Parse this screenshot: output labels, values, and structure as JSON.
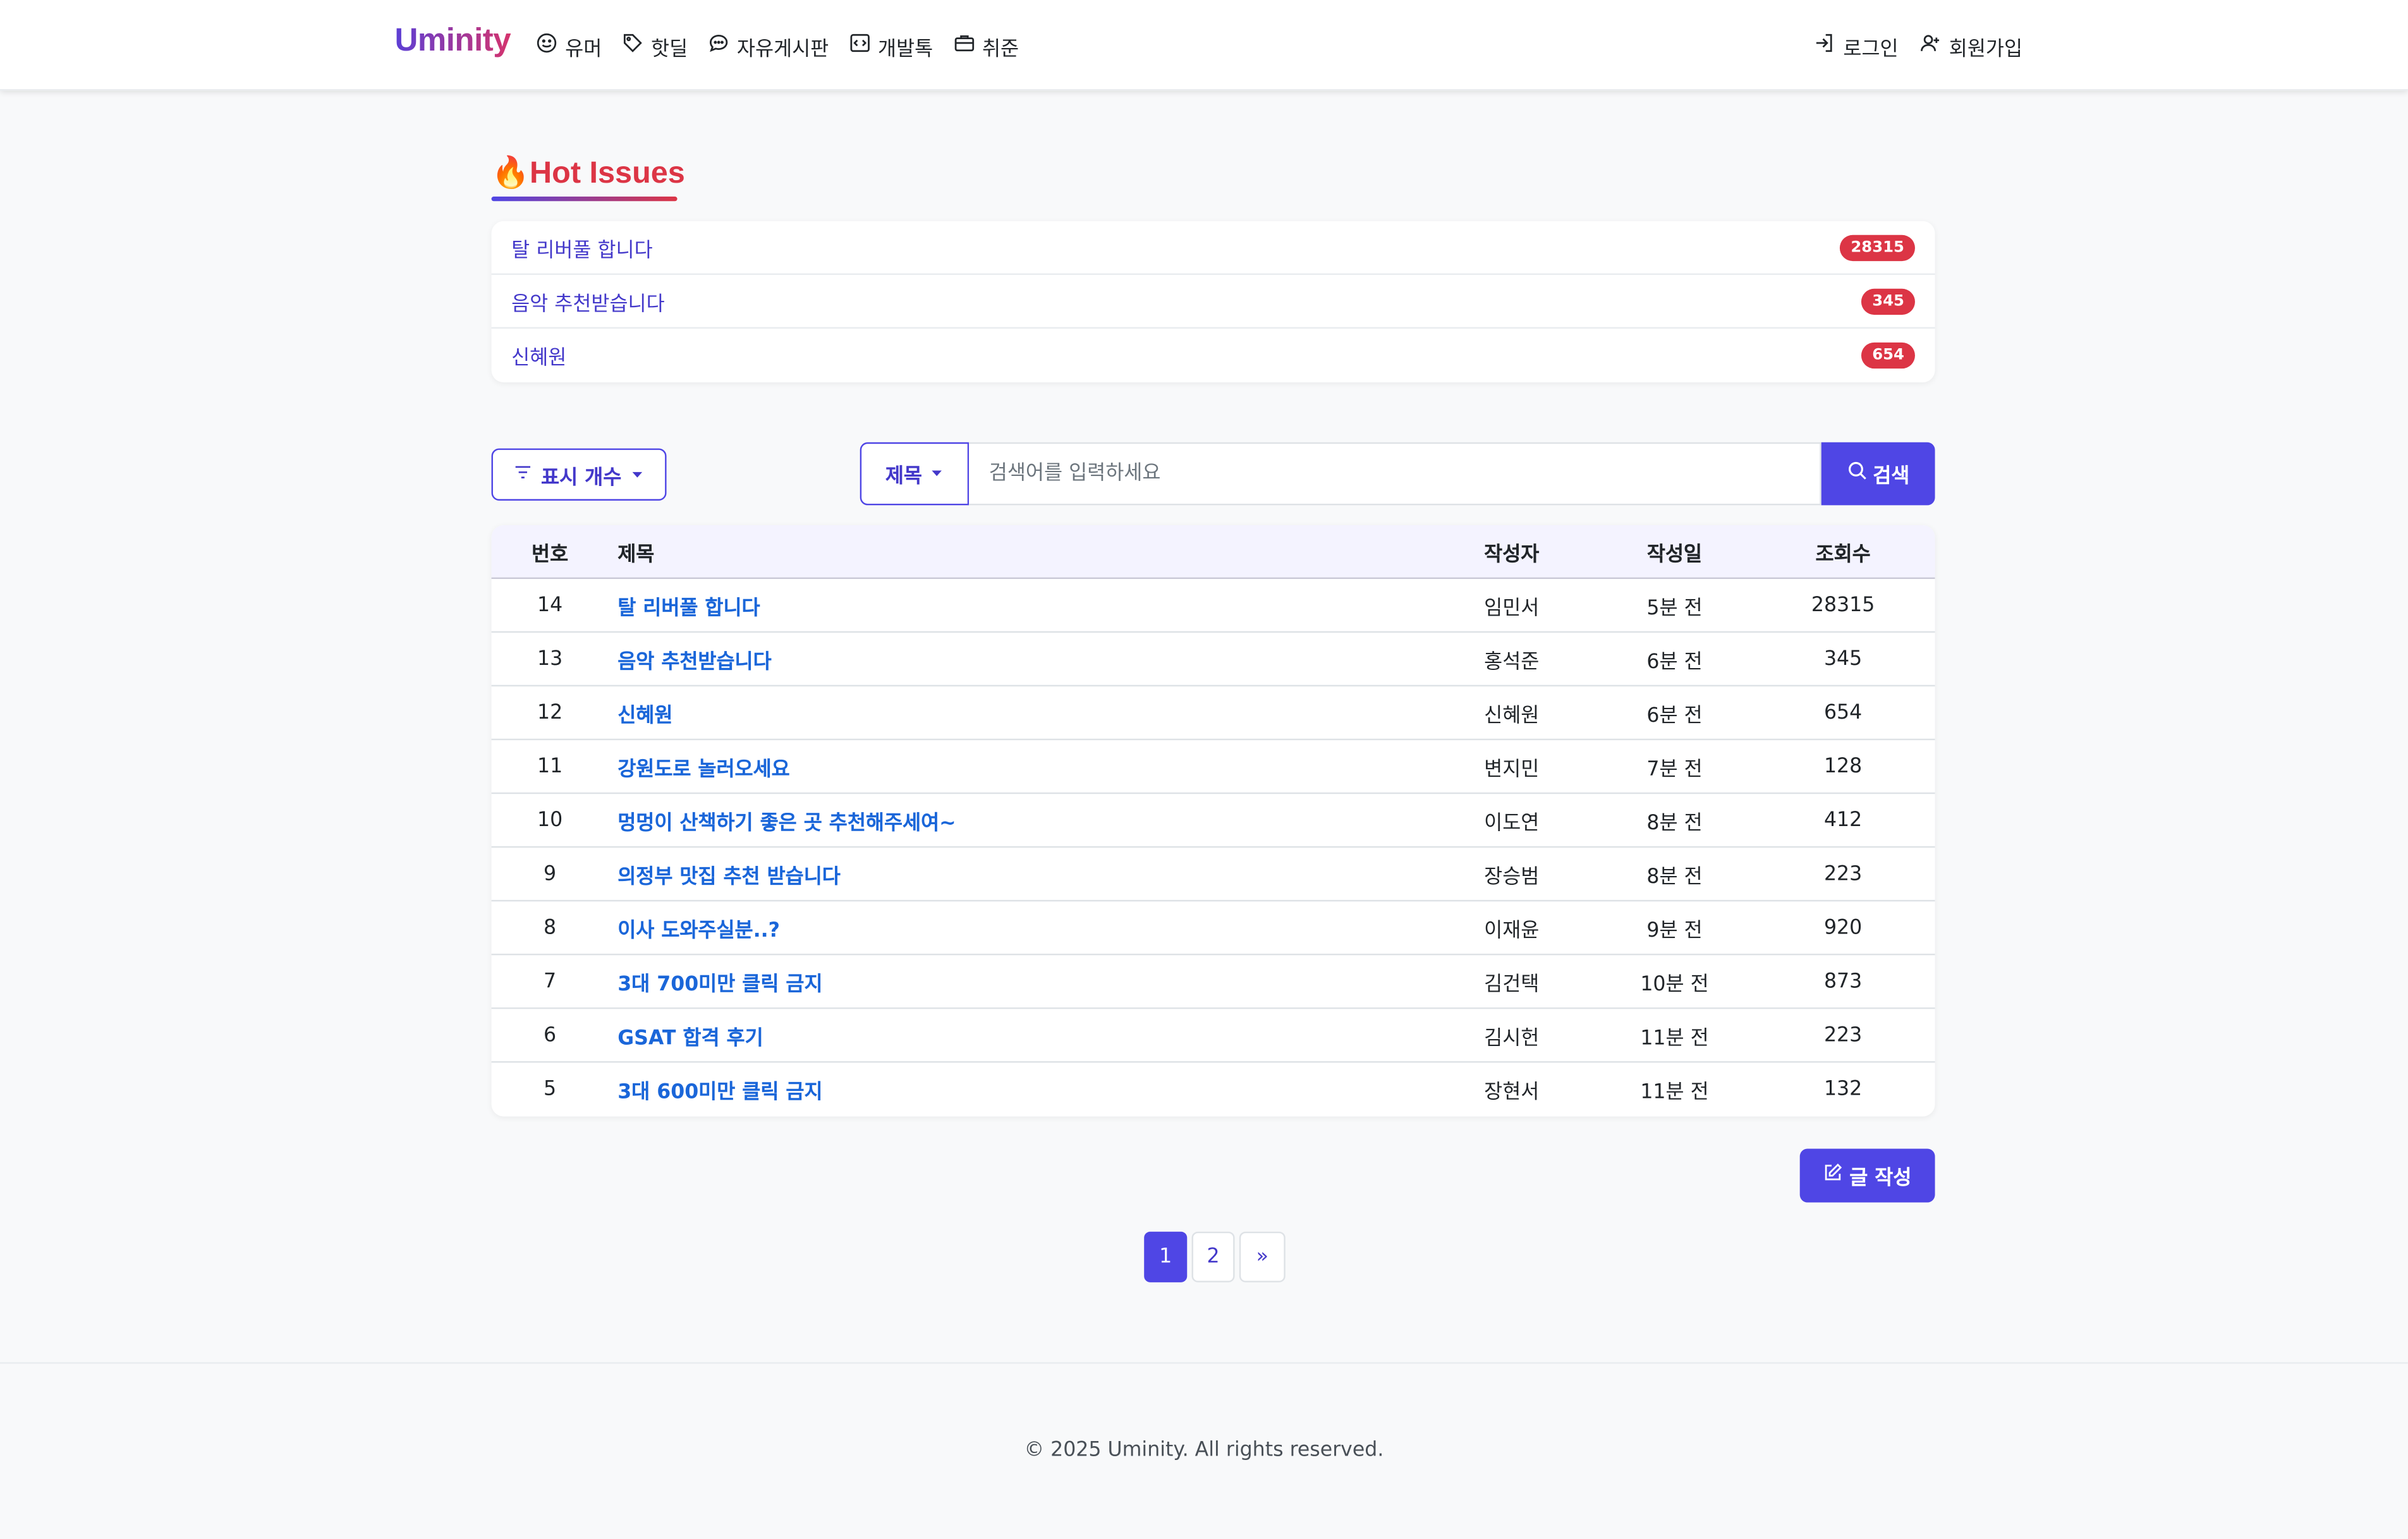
{
  "nav": {
    "brand": "Uminity",
    "links": [
      {
        "label": "유머",
        "icon": "smile-icon"
      },
      {
        "label": "핫딜",
        "icon": "tag-icon"
      },
      {
        "label": "자유게시판",
        "icon": "chat-icon"
      },
      {
        "label": "개발톡",
        "icon": "code-icon"
      },
      {
        "label": "취준",
        "icon": "briefcase-icon"
      }
    ],
    "login": "로그인",
    "signup": "회원가입"
  },
  "hot": {
    "title": "Hot Issues",
    "emoji": "🔥",
    "items": [
      {
        "title": "탈 리버풀 합니다",
        "count": "28315"
      },
      {
        "title": "음악 추천받습니다",
        "count": "345"
      },
      {
        "title": "신혜원",
        "count": "654"
      }
    ]
  },
  "controls": {
    "count_label": "표시 개수",
    "search_type": "제목",
    "search_placeholder": "검색어를 입력하세요",
    "search_button": "검색"
  },
  "table": {
    "headers": {
      "no": "번호",
      "title": "제목",
      "author": "작성자",
      "date": "작성일",
      "views": "조회수"
    },
    "rows": [
      {
        "no": "14",
        "title": "탈 리버풀 합니다",
        "author": "임민서",
        "date": "5분 전",
        "views": "28315"
      },
      {
        "no": "13",
        "title": "음악 추천받습니다",
        "author": "홍석준",
        "date": "6분 전",
        "views": "345"
      },
      {
        "no": "12",
        "title": "신혜원",
        "author": "신혜원",
        "date": "6분 전",
        "views": "654"
      },
      {
        "no": "11",
        "title": "강원도로 놀러오세요",
        "author": "변지민",
        "date": "7분 전",
        "views": "128"
      },
      {
        "no": "10",
        "title": "멍멍이 산책하기 좋은 곳 추천해주세여~",
        "author": "이도연",
        "date": "8분 전",
        "views": "412"
      },
      {
        "no": "9",
        "title": "의정부 맛집 추천 받습니다",
        "author": "장승범",
        "date": "8분 전",
        "views": "223"
      },
      {
        "no": "8",
        "title": "이사 도와주실분..?",
        "author": "이재윤",
        "date": "9분 전",
        "views": "920"
      },
      {
        "no": "7",
        "title": "3대 700미만 클릭 금지",
        "author": "김건택",
        "date": "10분 전",
        "views": "873"
      },
      {
        "no": "6",
        "title": "GSAT 합격 후기",
        "author": "김시헌",
        "date": "11분 전",
        "views": "223"
      },
      {
        "no": "5",
        "title": "3대 600미만 클릭 금지",
        "author": "장현서",
        "date": "11분 전",
        "views": "132"
      }
    ]
  },
  "write_button": "글 작성",
  "pagination": {
    "pages": [
      "1",
      "2"
    ],
    "current": "1",
    "next": "»"
  },
  "footer": "© 2025 Uminity. All rights reserved.",
  "colors": {
    "primary": "#4f46e5",
    "danger": "#dc3545",
    "link": "#1a66d9"
  }
}
